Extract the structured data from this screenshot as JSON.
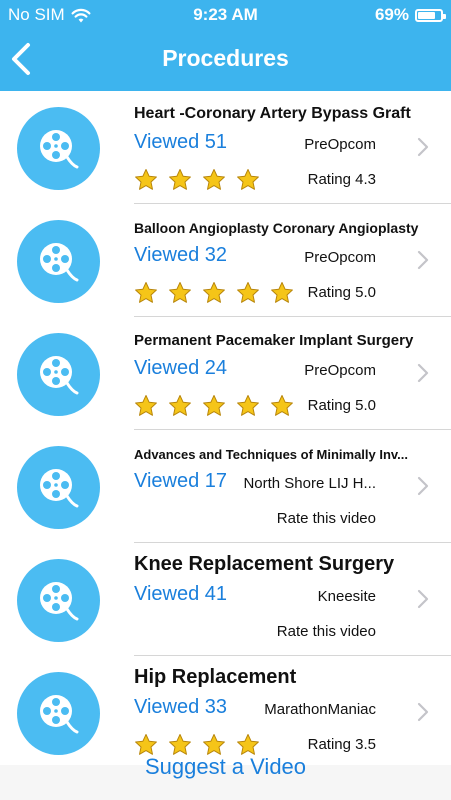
{
  "status_bar": {
    "carrier": "No SIM",
    "time": "9:23 AM",
    "battery": "69%",
    "battery_level": 0.69
  },
  "nav": {
    "title": "Procedures",
    "back_icon": "chevron-left-icon"
  },
  "colors": {
    "accent": "#3db4ee",
    "link": "#1a7fdc",
    "thumb": "#4bbcf2",
    "star": "#f5c518"
  },
  "procedures": [
    {
      "title": "Heart -Coronary Artery Bypass Graft",
      "views": "Viewed 51",
      "source": "PreOpcom",
      "stars": 4,
      "rating": "Rating 4.3",
      "rate_prompt": ""
    },
    {
      "title": "Balloon Angioplasty Coronary Angioplasty",
      "views": "Viewed 32",
      "source": "PreOpcom",
      "stars": 5,
      "rating": "Rating 5.0",
      "rate_prompt": ""
    },
    {
      "title": "Permanent Pacemaker Implant Surgery",
      "views": "Viewed 24",
      "source": "PreOpcom",
      "stars": 5,
      "rating": "Rating 5.0",
      "rate_prompt": ""
    },
    {
      "title": "Advances and Techniques of Minimally Inv...",
      "views": "Viewed 17",
      "source": "North Shore LIJ H...",
      "stars": 0,
      "rating": "",
      "rate_prompt": "Rate this video"
    },
    {
      "title": "Knee Replacement Surgery",
      "views": "Viewed 41",
      "source": "Kneesite",
      "stars": 0,
      "rating": "",
      "rate_prompt": "Rate this video"
    },
    {
      "title": "Hip Replacement",
      "views": "Viewed 33",
      "source": "MarathonManiac",
      "stars": 4,
      "rating": "Rating 3.5",
      "rate_prompt": ""
    }
  ],
  "footer": {
    "suggest_label": "Suggest a Video"
  }
}
